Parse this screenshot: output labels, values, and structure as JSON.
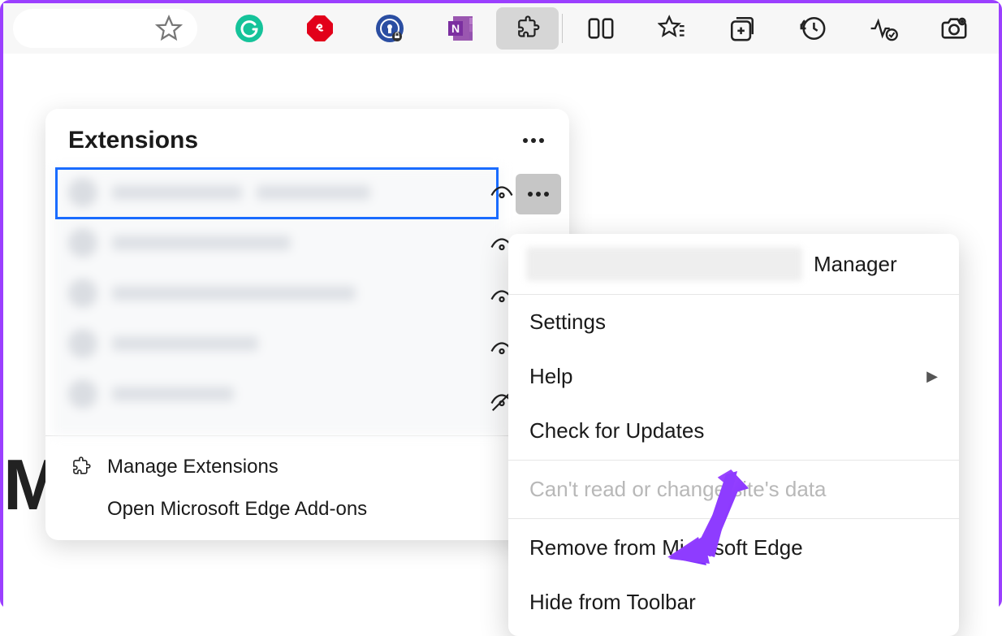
{
  "toolbar": {
    "icons": [
      "star",
      "grammarly",
      "adblock",
      "lastpass",
      "onenote",
      "extensions",
      "split",
      "favorites",
      "collections",
      "history",
      "performance",
      "screenshot"
    ]
  },
  "background_text": "Mi",
  "extensions_panel": {
    "title": "Extensions",
    "items_eye_state": [
      "visible",
      "visible",
      "visible",
      "visible",
      "hidden"
    ],
    "footer": {
      "manage": "Manage Extensions",
      "addons": "Open Microsoft Edge Add-ons"
    }
  },
  "context_menu": {
    "header_suffix": "Manager",
    "items": {
      "settings": "Settings",
      "help": "Help",
      "check_updates": "Check for Updates",
      "site_data": "Can't read or change site's data",
      "remove": "Remove from Microsoft Edge",
      "hide": "Hide from Toolbar"
    }
  }
}
